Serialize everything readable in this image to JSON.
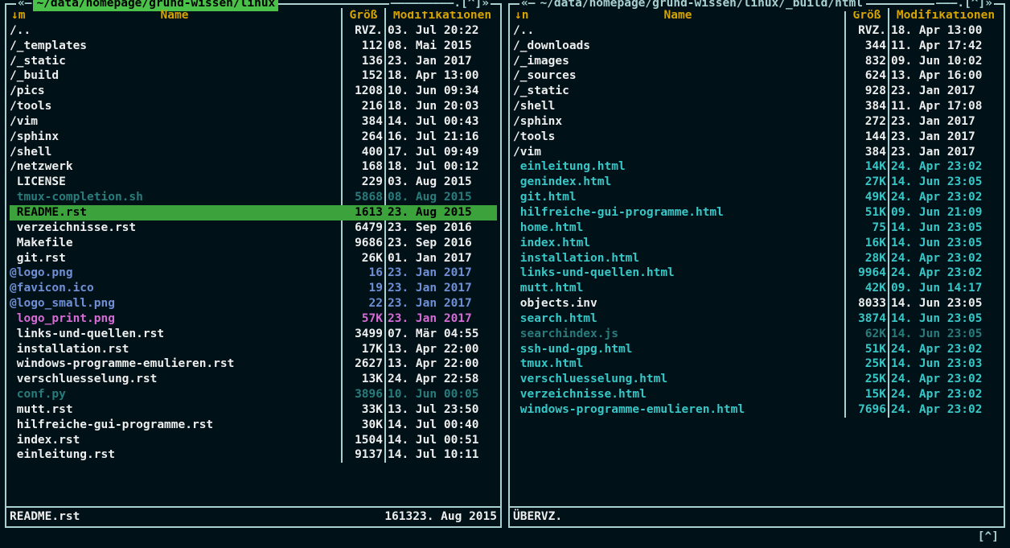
{
  "colors": {
    "accent_green": "#3ca23c",
    "frame": "#a8d0d0",
    "gold": "#d6a300"
  },
  "panels": [
    {
      "id": "left",
      "active": true,
      "title_pre": "«— ",
      "path": "~/data/homepage/grund-wissen/linux",
      "title_post": "—————————.[^]»",
      "headers": {
        "arrow": "↓m",
        "name": "Name",
        "size": "Größ",
        "mod": "Modifikationen"
      },
      "rows": [
        {
          "name": "/..",
          "size": "RVZ.",
          "mod": "03. Jul 20:22",
          "cls": "dir"
        },
        {
          "name": "/_templates",
          "size": "112",
          "mod": "08. Mai 2015",
          "cls": "dir"
        },
        {
          "name": "/_static",
          "size": "136",
          "mod": "23. Jan 2017",
          "cls": "dir"
        },
        {
          "name": "/_build",
          "size": "152",
          "mod": "18. Apr 13:00",
          "cls": "dir"
        },
        {
          "name": "/pics",
          "size": "1208",
          "mod": "10. Jun 09:34",
          "cls": "dir"
        },
        {
          "name": "/tools",
          "size": "216",
          "mod": "18. Jun 20:03",
          "cls": "dir"
        },
        {
          "name": "/vim",
          "size": "384",
          "mod": "14. Jul 00:43",
          "cls": "dir"
        },
        {
          "name": "/sphinx",
          "size": "264",
          "mod": "16. Jul 21:16",
          "cls": "dir"
        },
        {
          "name": "/shell",
          "size": "400",
          "mod": "17. Jul 09:49",
          "cls": "dir"
        },
        {
          "name": "/netzwerk",
          "size": "168",
          "mod": "18. Jul 00:12",
          "cls": "dir"
        },
        {
          "name": " LICENSE",
          "size": "229",
          "mod": "03. Aug 2015",
          "cls": "white"
        },
        {
          "name": " tmux-completion.sh",
          "size": "5868",
          "mod": "08. Aug 2015",
          "cls": "cyan-dim"
        },
        {
          "name": " README.rst",
          "size": "1613",
          "mod": "23. Aug 2015",
          "cls": "white",
          "selected": true
        },
        {
          "name": " verzeichnisse.rst",
          "size": "6479",
          "mod": "23. Sep 2016",
          "cls": "white"
        },
        {
          "name": " Makefile",
          "size": "9686",
          "mod": "23. Sep 2016",
          "cls": "white"
        },
        {
          "name": " git.rst",
          "size": "26K",
          "mod": "01. Jan 2017",
          "cls": "white"
        },
        {
          "name": "@logo.png",
          "size": "16",
          "mod": "23. Jan 2017",
          "cls": "blue"
        },
        {
          "name": "@favicon.ico",
          "size": "19",
          "mod": "23. Jan 2017",
          "cls": "blue"
        },
        {
          "name": "@logo_small.png",
          "size": "22",
          "mod": "23. Jan 2017",
          "cls": "blue"
        },
        {
          "name": " logo_print.png",
          "size": "57K",
          "mod": "23. Jan 2017",
          "cls": "magenta"
        },
        {
          "name": " links-und-quellen.rst",
          "size": "3499",
          "mod": "07. Mär 04:55",
          "cls": "white"
        },
        {
          "name": " installation.rst",
          "size": "17K",
          "mod": "13. Apr 22:00",
          "cls": "white"
        },
        {
          "name": " windows-programme-emulieren.rst",
          "size": "2627",
          "mod": "13. Apr 22:00",
          "cls": "white"
        },
        {
          "name": " verschluesselung.rst",
          "size": "13K",
          "mod": "24. Apr 22:58",
          "cls": "white"
        },
        {
          "name": " conf.py",
          "size": "3896",
          "mod": "10. Jun 00:05",
          "cls": "cyan-dim"
        },
        {
          "name": " mutt.rst",
          "size": "33K",
          "mod": "13. Jul 23:50",
          "cls": "white"
        },
        {
          "name": " hilfreiche-gui-programme.rst",
          "size": "30K",
          "mod": "14. Jul 00:40",
          "cls": "white"
        },
        {
          "name": " index.rst",
          "size": "1504",
          "mod": "14. Jul 00:51",
          "cls": "white"
        },
        {
          "name": " einleitung.rst",
          "size": "9137",
          "mod": "14. Jul 10:11",
          "cls": "white"
        }
      ],
      "footer": {
        "name": " README.rst",
        "size": "1613",
        "mod": "23. Aug 2015"
      }
    },
    {
      "id": "right",
      "active": false,
      "title_pre": "«— ",
      "path": "~/data/homepage/grund-wissen/linux/_build/html",
      "title_post": "———.[^]»",
      "headers": {
        "arrow": "↓n",
        "name": "Name",
        "size": "Größ",
        "mod": "Modifikationen"
      },
      "rows": [
        {
          "name": "/..",
          "size": "RVZ.",
          "mod": "18. Apr 13:00",
          "cls": "dir"
        },
        {
          "name": "/_downloads",
          "size": "344",
          "mod": "11. Apr 17:42",
          "cls": "dir"
        },
        {
          "name": "/_images",
          "size": "832",
          "mod": "09. Jun 10:02",
          "cls": "dir"
        },
        {
          "name": "/_sources",
          "size": "624",
          "mod": "13. Apr 16:00",
          "cls": "dir"
        },
        {
          "name": "/_static",
          "size": "928",
          "mod": "23. Jan 2017",
          "cls": "dir"
        },
        {
          "name": "/shell",
          "size": "384",
          "mod": "11. Apr 17:08",
          "cls": "dir"
        },
        {
          "name": "/sphinx",
          "size": "272",
          "mod": "23. Jan 2017",
          "cls": "dir"
        },
        {
          "name": "/tools",
          "size": "144",
          "mod": "23. Jan 2017",
          "cls": "dir"
        },
        {
          "name": "/vim",
          "size": "384",
          "mod": "23. Jan 2017",
          "cls": "dir"
        },
        {
          "name": " einleitung.html",
          "size": "14K",
          "mod": "24. Apr 23:02",
          "cls": "cyan"
        },
        {
          "name": " genindex.html",
          "size": "27K",
          "mod": "14. Jun 23:05",
          "cls": "cyan"
        },
        {
          "name": " git.html",
          "size": "49K",
          "mod": "24. Apr 23:02",
          "cls": "cyan"
        },
        {
          "name": " hilfreiche-gui-programme.html",
          "size": "51K",
          "mod": "09. Jun 21:09",
          "cls": "cyan"
        },
        {
          "name": " home.html",
          "size": "75",
          "mod": "14. Jun 23:05",
          "cls": "cyan"
        },
        {
          "name": " index.html",
          "size": "16K",
          "mod": "14. Jun 23:05",
          "cls": "cyan"
        },
        {
          "name": " installation.html",
          "size": "28K",
          "mod": "24. Apr 23:02",
          "cls": "cyan"
        },
        {
          "name": " links-und-quellen.html",
          "size": "9964",
          "mod": "24. Apr 23:02",
          "cls": "cyan"
        },
        {
          "name": " mutt.html",
          "size": "42K",
          "mod": "09. Jun 14:17",
          "cls": "cyan"
        },
        {
          "name": " objects.inv",
          "size": "8033",
          "mod": "14. Jun 23:05",
          "cls": "white"
        },
        {
          "name": " search.html",
          "size": "3874",
          "mod": "14. Jun 23:05",
          "cls": "cyan"
        },
        {
          "name": " searchindex.js",
          "size": "62K",
          "mod": "14. Jun 23:05",
          "cls": "cyan-dim"
        },
        {
          "name": " ssh-und-gpg.html",
          "size": "51K",
          "mod": "24. Apr 23:02",
          "cls": "cyan"
        },
        {
          "name": " tmux.html",
          "size": "25K",
          "mod": "14. Jun 23:03",
          "cls": "cyan"
        },
        {
          "name": " verschluesselung.html",
          "size": "25K",
          "mod": "24. Apr 23:02",
          "cls": "cyan"
        },
        {
          "name": " verzeichnisse.html",
          "size": "15K",
          "mod": "24. Apr 23:02",
          "cls": "cyan"
        },
        {
          "name": " windows-programme-emulieren.html",
          "size": "7696",
          "mod": "24. Apr 23:02",
          "cls": "cyan"
        }
      ],
      "footer": {
        "name": "ÜBERVZ.",
        "size": "",
        "mod": ""
      }
    }
  ],
  "bottom": "[^]"
}
